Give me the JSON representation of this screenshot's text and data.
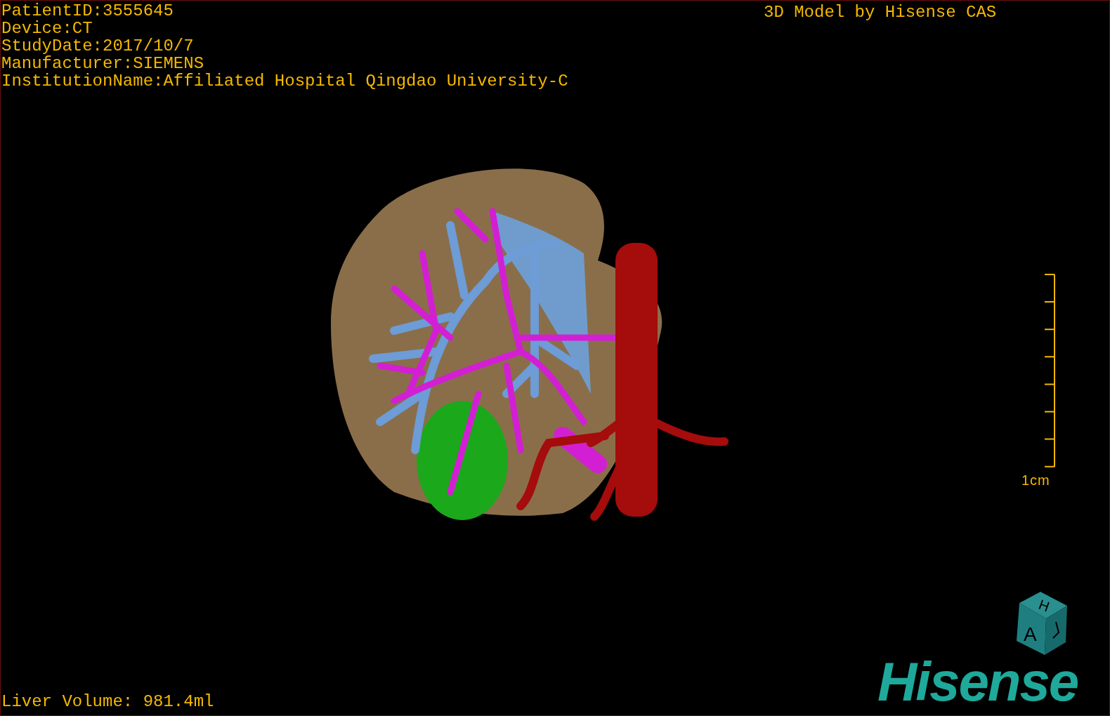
{
  "study_info": [
    "PatientID:3555645",
    "Device:CT",
    "StudyDate:2017/10/7",
    "Manufacturer:SIEMENS",
    "InstitutionName:Affiliated Hospital Qingdao University-C"
  ],
  "credit": "3D Model by Hisense CAS",
  "scale_bar": {
    "label": "1cm"
  },
  "orientation_cube": {
    "faces": [
      "H",
      "A"
    ]
  },
  "logo": "Hisense",
  "measurement": "Liver Volume: 981.4ml"
}
